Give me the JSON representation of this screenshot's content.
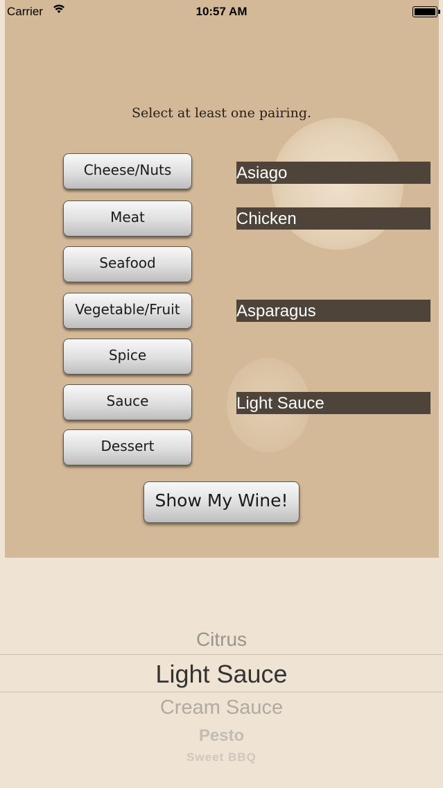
{
  "status_bar": {
    "carrier": "Carrier",
    "time": "10:57 AM",
    "wifi_icon": "wifi-icon",
    "battery_icon": "battery-icon"
  },
  "instruction": "Select at least one pairing.",
  "categories": [
    {
      "label": "Cheese/Nuts",
      "selection": "Asiago"
    },
    {
      "label": "Meat",
      "selection": "Chicken"
    },
    {
      "label": "Seafood",
      "selection": ""
    },
    {
      "label": "Vegetable/Fruit",
      "selection": "Asparagus"
    },
    {
      "label": "Spice",
      "selection": ""
    },
    {
      "label": "Sauce",
      "selection": "Light Sauce"
    },
    {
      "label": "Dessert",
      "selection": ""
    }
  ],
  "show_button": "Show My Wine!",
  "picker": {
    "items": [
      "Citrus",
      "Light Sauce",
      "Cream Sauce",
      "Pesto",
      "Sweet BBQ"
    ],
    "selected": "Light Sauce"
  },
  "colors": {
    "background": "#d4b998",
    "selection_bar": "#4e443a",
    "picker_background": "#efe4d3"
  }
}
